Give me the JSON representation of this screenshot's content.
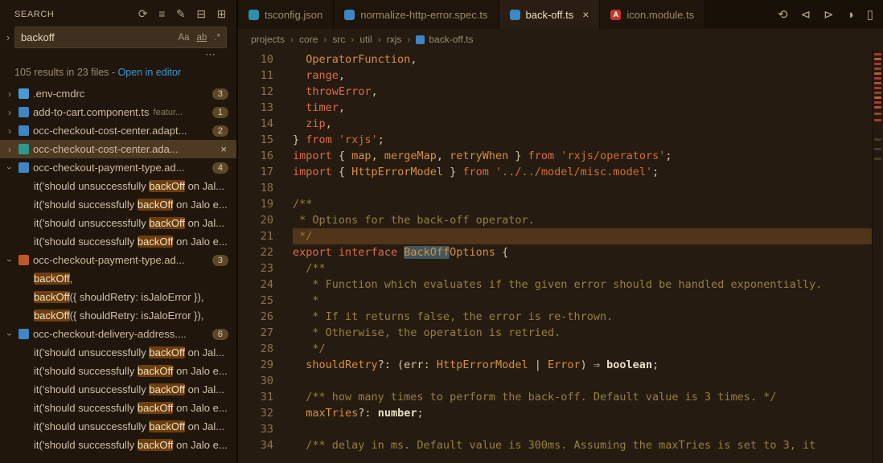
{
  "colors": {
    "accent_link": "#3b9ad8",
    "match_highlight_bg": "#6d3e0e",
    "selection_line_bg": "#50351a",
    "word_highlight_bg": "#42565c"
  },
  "sidebar": {
    "title": "SEARCH",
    "actions": [
      {
        "name": "refresh-icon",
        "glyph": "⟳"
      },
      {
        "name": "clear-results-icon",
        "glyph": "≡"
      },
      {
        "name": "new-search-editor-icon",
        "glyph": "✎"
      },
      {
        "name": "collapse-all-icon",
        "glyph": "⊟"
      },
      {
        "name": "view-as-list-icon",
        "glyph": "⊞"
      }
    ],
    "expand_glyph": "›",
    "more_glyph": "⋯",
    "search": {
      "value": "backoff",
      "toggles": [
        {
          "name": "match-case-toggle",
          "glyph": "Aa",
          "underline": false
        },
        {
          "name": "whole-word-toggle",
          "glyph": "ab",
          "underline": true
        },
        {
          "name": "regex-toggle",
          "glyph": ".*",
          "underline": false
        }
      ]
    },
    "summary_text": "105 results in 23 files",
    "summary_sep": " - ",
    "open_in_editor": "Open in editor",
    "results": [
      {
        "kind": "file",
        "icon": "lightblue",
        "icon_name": "env-file-icon",
        "name": ".env-cmdrc",
        "path": "",
        "badge": "3",
        "expanded": false
      },
      {
        "kind": "file",
        "icon": "blue",
        "icon_name": "angular-component-icon",
        "name": "add-to-cart.component.ts",
        "path": "featur...",
        "badge": "1",
        "expanded": false
      },
      {
        "kind": "file",
        "icon": "blue",
        "icon_name": "typescript-file-icon",
        "name": "occ-checkout-cost-center.adapt...",
        "path": "",
        "badge": "2",
        "expanded": false
      },
      {
        "kind": "file",
        "icon": "teal",
        "icon_name": "typescript-file-icon",
        "name": "occ-checkout-cost-center.ada...",
        "path": "",
        "close": "×",
        "selected": true,
        "expanded": false
      },
      {
        "kind": "file",
        "icon": "blue",
        "icon_name": "spec-file-icon",
        "name": "occ-checkout-payment-type.ad...",
        "path": "",
        "badge": "4",
        "expanded": true
      },
      {
        "kind": "match",
        "pre": "it('should unsuccessfully ",
        "match": "backOff",
        "post": " on Jal..."
      },
      {
        "kind": "match",
        "pre": "it('should successfully ",
        "match": "backOff",
        "post": " on Jalo e..."
      },
      {
        "kind": "match",
        "pre": "it('should unsuccessfully ",
        "match": "backOff",
        "post": " on Jal..."
      },
      {
        "kind": "match",
        "pre": "it('should successfully ",
        "match": "backOff",
        "post": " on Jalo e..."
      },
      {
        "kind": "file",
        "icon": "orange",
        "icon_name": "typescript-file-icon",
        "name": "occ-checkout-payment-type.ad...",
        "path": "",
        "badge": "3",
        "expanded": true
      },
      {
        "kind": "match",
        "pre": "",
        "match": "backOff",
        "post": ","
      },
      {
        "kind": "match",
        "pre": "",
        "match": "backOff",
        "post": "({ shouldRetry: isJaloError }),"
      },
      {
        "kind": "match",
        "pre": "",
        "match": "backOff",
        "post": "({ shouldRetry: isJaloError }),"
      },
      {
        "kind": "file",
        "icon": "blue",
        "icon_name": "angular-component-icon",
        "name": "occ-checkout-delivery-address....",
        "path": "",
        "badge": "6",
        "expanded": true
      },
      {
        "kind": "match",
        "pre": "it('should unsuccessfully ",
        "match": "backOff",
        "post": " on Jal..."
      },
      {
        "kind": "match",
        "pre": "it('should successfully ",
        "match": "backOff",
        "post": " on Jalo e..."
      },
      {
        "kind": "match",
        "pre": "it('should unsuccessfully ",
        "match": "backOff",
        "post": " on Jal..."
      },
      {
        "kind": "match",
        "pre": "it('should successfully ",
        "match": "backOff",
        "post": " on Jalo e..."
      },
      {
        "kind": "match",
        "pre": "it('should unsuccessfully ",
        "match": "backOff",
        "post": " on Jal..."
      },
      {
        "kind": "match",
        "pre": "it('should successfully ",
        "match": "backOff",
        "post": " on Jalo e..."
      }
    ]
  },
  "editor": {
    "tabs": [
      {
        "label": "tsconfig.json",
        "icon": "teal",
        "icon_name": "tsconfig-icon",
        "active": false
      },
      {
        "label": "normalize-http-error.spec.ts",
        "icon": "blue",
        "icon_name": "angular-spec-icon",
        "active": false
      },
      {
        "label": "back-off.ts",
        "icon": "blue",
        "icon_name": "typescript-icon",
        "active": true,
        "close": "×"
      },
      {
        "label": "icon.module.ts",
        "icon": "red",
        "icon_name": "angular-module-icon",
        "letter": "A",
        "active": false
      }
    ],
    "actions": [
      {
        "name": "timeline-icon",
        "glyph": "⟲"
      },
      {
        "name": "navigate-back-icon",
        "glyph": "⊲"
      },
      {
        "name": "navigate-forward-icon",
        "glyph": "⊳"
      },
      {
        "name": "open-changes-icon",
        "glyph": "◑"
      },
      {
        "name": "split-editor-icon",
        "glyph": "▯"
      }
    ],
    "breadcrumbs": [
      "projects",
      "core",
      "src",
      "util",
      "rxjs",
      "back-off.ts"
    ],
    "breadcrumb_sep": "›",
    "code": {
      "lines": [
        {
          "n": 10,
          "t": [
            [
              "  ",
              "fg"
            ],
            [
              "OperatorFunction",
              "type"
            ],
            [
              ",",
              "fg"
            ]
          ]
        },
        {
          "n": 11,
          "t": [
            [
              "  ",
              "fg"
            ],
            [
              "range",
              "red"
            ],
            [
              ",",
              "fg"
            ]
          ]
        },
        {
          "n": 12,
          "t": [
            [
              "  ",
              "fg"
            ],
            [
              "throwError",
              "red"
            ],
            [
              ",",
              "fg"
            ]
          ]
        },
        {
          "n": 13,
          "t": [
            [
              "  ",
              "fg"
            ],
            [
              "timer",
              "red"
            ],
            [
              ",",
              "fg"
            ]
          ]
        },
        {
          "n": 14,
          "t": [
            [
              "  ",
              "fg"
            ],
            [
              "zip",
              "red"
            ],
            [
              ",",
              "fg"
            ]
          ]
        },
        {
          "n": 15,
          "t": [
            [
              "} ",
              "fg"
            ],
            [
              "from",
              "red"
            ],
            [
              " ",
              "fg"
            ],
            [
              "'rxjs'",
              "str"
            ],
            [
              ";",
              "fg"
            ]
          ]
        },
        {
          "n": 16,
          "t": [
            [
              "import",
              "red"
            ],
            [
              " { ",
              "fg"
            ],
            [
              "map",
              "type"
            ],
            [
              ", ",
              "fg"
            ],
            [
              "mergeMap",
              "type"
            ],
            [
              ", ",
              "fg"
            ],
            [
              "retryWhen",
              "type"
            ],
            [
              " } ",
              "fg"
            ],
            [
              "from",
              "red"
            ],
            [
              " ",
              "fg"
            ],
            [
              "'rxjs/operators'",
              "str"
            ],
            [
              ";",
              "fg"
            ]
          ]
        },
        {
          "n": 17,
          "t": [
            [
              "import",
              "red"
            ],
            [
              " { ",
              "fg"
            ],
            [
              "HttpErrorModel",
              "type"
            ],
            [
              " } ",
              "fg"
            ],
            [
              "from",
              "red"
            ],
            [
              " ",
              "fg"
            ],
            [
              "'../../model/misc.model'",
              "str"
            ],
            [
              ";",
              "fg"
            ]
          ]
        },
        {
          "n": 18,
          "t": []
        },
        {
          "n": 19,
          "t": [
            [
              "/**",
              "cmt"
            ]
          ]
        },
        {
          "n": 20,
          "t": [
            [
              " * Options for the back-off operator.",
              "cmt"
            ]
          ]
        },
        {
          "n": 21,
          "sel": true,
          "t": [
            [
              " */",
              "cmt"
            ]
          ]
        },
        {
          "n": 22,
          "t": [
            [
              "export",
              "red"
            ],
            [
              " ",
              "fg"
            ],
            [
              "interface",
              "red"
            ],
            [
              " ",
              "fg"
            ],
            [
              "BackOff",
              "type",
              true
            ],
            [
              "Options",
              "type"
            ],
            [
              " {",
              "fg"
            ]
          ]
        },
        {
          "n": 23,
          "t": [
            [
              "  /**",
              "cmt"
            ]
          ]
        },
        {
          "n": 24,
          "t": [
            [
              "   * Function which evaluates if the given error should be handled exponentially.",
              "cmt"
            ]
          ]
        },
        {
          "n": 25,
          "t": [
            [
              "   *",
              "cmt"
            ]
          ]
        },
        {
          "n": 26,
          "t": [
            [
              "   * If it returns false, the error is re-thrown.",
              "cmt"
            ]
          ]
        },
        {
          "n": 27,
          "t": [
            [
              "   * Otherwise, the operation is retried.",
              "cmt"
            ]
          ]
        },
        {
          "n": 28,
          "t": [
            [
              "   */",
              "cmt"
            ]
          ]
        },
        {
          "n": 29,
          "t": [
            [
              "  ",
              "fg"
            ],
            [
              "shouldRetry",
              "type"
            ],
            [
              "?: (err: ",
              "fg"
            ],
            [
              "HttpErrorModel",
              "type"
            ],
            [
              " | ",
              "fg"
            ],
            [
              "Error",
              "type"
            ],
            [
              ") ⇒ ",
              "fg"
            ],
            [
              "boolean",
              "prim"
            ],
            [
              ";",
              "fg"
            ]
          ]
        },
        {
          "n": 30,
          "t": []
        },
        {
          "n": 31,
          "t": [
            [
              "  /** how many times to perform the back-off. Default value is 3 times. */",
              "cmt"
            ]
          ]
        },
        {
          "n": 32,
          "t": [
            [
              "  ",
              "fg"
            ],
            [
              "maxTries",
              "type"
            ],
            [
              "?: ",
              "fg"
            ],
            [
              "number",
              "prim"
            ],
            [
              ";",
              "fg"
            ]
          ]
        },
        {
          "n": 33,
          "t": []
        },
        {
          "n": 34,
          "t": [
            [
              "  /** delay in ms. Default value is 300ms. Assuming the maxTries is set to 3, it",
              "cmt"
            ]
          ]
        }
      ]
    }
  }
}
